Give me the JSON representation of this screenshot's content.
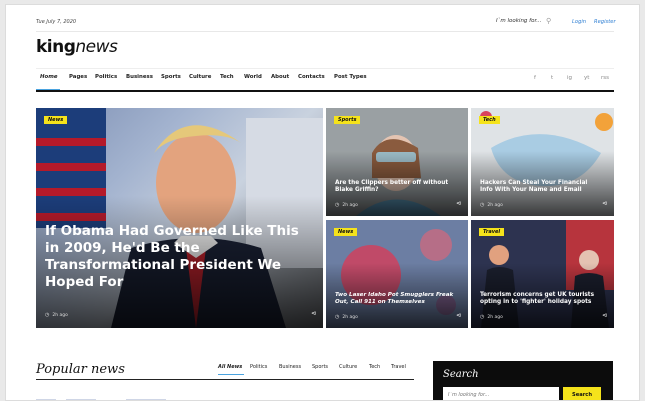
{
  "topbar": {
    "date": "Tue July 7, 2020",
    "search_placeholder": "I`m looking for...",
    "login": "Login",
    "register": "Register"
  },
  "logo": {
    "bold": "king",
    "italic": "news"
  },
  "nav": [
    "Home",
    "Pages",
    "Politics",
    "Business",
    "Sports",
    "Culture",
    "Tech",
    "World",
    "About",
    "Contacts",
    "Post Types"
  ],
  "social": [
    "f",
    "t",
    "ig",
    "yt",
    "rss"
  ],
  "hero": {
    "main": {
      "badge": "News",
      "title": "If Obama Had Governed Like This in 2009, He'd Be the Transformational President We Hoped For",
      "time": "2h ago"
    },
    "c1": {
      "badge": "Sports",
      "title": "Are the Clippers better off without Blake Griffin?",
      "time": "2h ago"
    },
    "c2": {
      "badge": "Tech",
      "title": "Hackers Can Steal Your Financial Info With Your Name and Email",
      "time": "2h ago"
    },
    "c3": {
      "badge": "News",
      "title": "Two Laser Idaho Pot Smugglers Freak Out, Call 911 on Themselves",
      "time": "2h ago"
    },
    "c4": {
      "badge": "Travel",
      "title": "Terrorism concerns get UK tourists opting in to 'fighter' holiday spots",
      "time": "2h ago"
    }
  },
  "popular": {
    "heading": "Popular news",
    "tabs": [
      "All News",
      "Politics",
      "Business",
      "Sports",
      "Culture",
      "Tech",
      "Travel"
    ]
  },
  "search": {
    "heading": "Search",
    "placeholder": "I`m looking for...",
    "button": "Search"
  },
  "colors": {
    "accent": "#4aa3df",
    "badge": "#f5e31b",
    "link": "#2f7fd3"
  }
}
